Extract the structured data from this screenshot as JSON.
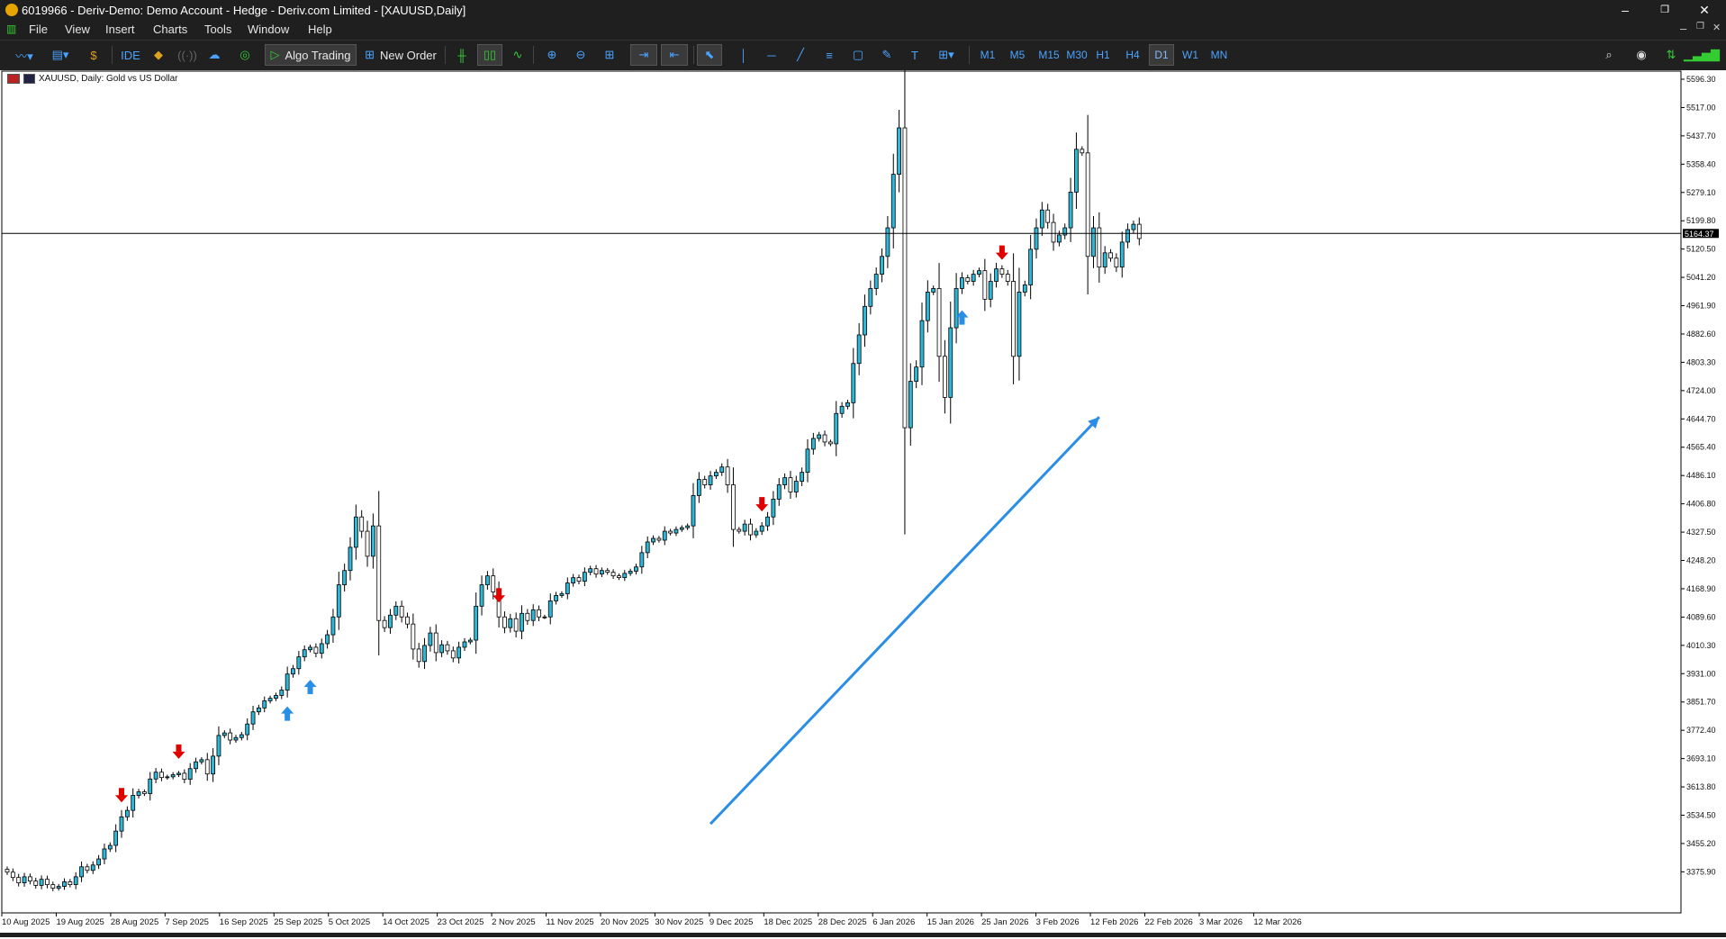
{
  "window": {
    "title": "6019966 - Deriv-Demo: Demo Account - Hedge - Deriv.com Limited - [XAUUSD,Daily]",
    "controls": {
      "minimize": "–",
      "maximize": "❐",
      "close": "✕"
    },
    "inner_controls": {
      "minimize": "–",
      "restore": "❐",
      "close": "✕"
    }
  },
  "menu": [
    "File",
    "View",
    "Insert",
    "Charts",
    "Tools",
    "Window",
    "Help"
  ],
  "toolbar": {
    "ide_label": "IDE",
    "algo_trading_label": "Algo Trading",
    "new_order_label": "New Order",
    "timeframes": [
      "M1",
      "M5",
      "M15",
      "M30",
      "H1",
      "H4",
      "D1",
      "W1",
      "MN"
    ],
    "active_timeframe": "D1"
  },
  "chart_label": "XAUUSD, Daily:  Gold vs US Dollar",
  "chart_data": {
    "type": "candlestick",
    "symbol": "XAUUSD",
    "period": "Daily",
    "description": "Gold vs US Dollar",
    "current_price_label": "5164.37",
    "current_price": 5164.37,
    "ylim": [
      3336.5,
      5596.3
    ],
    "y_ticks": [
      "5596.30",
      "5517.00",
      "5437.70",
      "5358.40",
      "5279.10",
      "5199.80",
      "5120.50",
      "5041.20",
      "4961.90",
      "4882.60",
      "4803.30",
      "4724.00",
      "4644.70",
      "4565.40",
      "4486.10",
      "4406.80",
      "4327.50",
      "4248.20",
      "4168.90",
      "4089.60",
      "4010.30",
      "3931.00",
      "3851.70",
      "3772.40",
      "3693.10",
      "3613.80",
      "3534.50",
      "3455.20",
      "3375.90"
    ],
    "x_ticks": [
      "10 Aug 2025",
      "19 Aug 2025",
      "28 Aug 2025",
      "7 Sep 2025",
      "16 Sep 2025",
      "25 Sep 2025",
      "5 Oct 2025",
      "14 Oct 2025",
      "23 Oct 2025",
      "2 Nov 2025",
      "11 Nov 2025",
      "20 Nov 2025",
      "30 Nov 2025",
      "9 Dec 2025",
      "18 Dec 2025",
      "28 Dec 2025",
      "6 Jan 2026",
      "15 Jan 2026",
      "25 Jan 2026",
      "3 Feb 2026",
      "12 Feb 2026",
      "22 Feb 2026",
      "3 Mar 2026",
      "12 Mar 2026"
    ],
    "closes": [
      3375,
      3360,
      3345,
      3362,
      3350,
      3338,
      3355,
      3340,
      3330,
      3335,
      3348,
      3340,
      3362,
      3390,
      3380,
      3395,
      3412,
      3440,
      3450,
      3490,
      3530,
      3548,
      3590,
      3600,
      3595,
      3636,
      3655,
      3640,
      3642,
      3648,
      3652,
      3635,
      3665,
      3684,
      3690,
      3650,
      3700,
      3758,
      3765,
      3745,
      3752,
      3760,
      3790,
      3824,
      3835,
      3855,
      3862,
      3870,
      3885,
      3930,
      3945,
      3978,
      3998,
      4005,
      3988,
      4015,
      4040,
      4090,
      4180,
      4220,
      4285,
      4370,
      4330,
      4260,
      4345,
      4080,
      4060,
      4095,
      4120,
      4090,
      4070,
      4000,
      3965,
      4010,
      4045,
      3990,
      4012,
      3995,
      3975,
      4005,
      4020,
      4025,
      4120,
      4180,
      4205,
      4160,
      4090,
      4060,
      4085,
      4050,
      4100,
      4080,
      4110,
      4090,
      4090,
      4135,
      4150,
      4155,
      4185,
      4200,
      4190,
      4215,
      4225,
      4210,
      4220,
      4215,
      4205,
      4200,
      4212,
      4218,
      4230,
      4270,
      4300,
      4310,
      4305,
      4330,
      4325,
      4335,
      4340,
      4345,
      4430,
      4475,
      4460,
      4485,
      4495,
      4510,
      4460,
      4335,
      4330,
      4350,
      4320,
      4330,
      4345,
      4370,
      4420,
      4460,
      4480,
      4440,
      4470,
      4495,
      4560,
      4590,
      4600,
      4580,
      4575,
      4660,
      4680,
      4690,
      4800,
      4880,
      4960,
      5010,
      5050,
      5100,
      5180,
      5330,
      5460,
      4620,
      4750,
      4790,
      4920,
      5000,
      5010,
      4820,
      4705,
      4900,
      5010,
      5040,
      5030,
      5050,
      5060,
      4980,
      5030,
      5065,
      5050,
      5030,
      4820,
      5000,
      5020,
      5120,
      5180,
      5230,
      5195,
      5140,
      5160,
      5180,
      5280,
      5400,
      5390,
      5100,
      5180,
      5070,
      5110,
      5095,
      5070,
      5140,
      5175,
      5190,
      5150
    ],
    "sell_arrow_bars": [
      20,
      30,
      86,
      132,
      174
    ],
    "buy_arrow_bars": [
      49,
      53,
      167
    ],
    "trend_arrow": {
      "from": {
        "bar": 123,
        "price": 3510
      },
      "to": {
        "bar": 191,
        "price": 4650
      }
    },
    "colors": {
      "bull_body": "#2db8d8",
      "bear_body": "#ffffff",
      "outline": "#000000",
      "sell_arrow": "#e00000",
      "buy_arrow": "#2a8ee6",
      "trend_arrow": "#2a8ee6"
    }
  }
}
